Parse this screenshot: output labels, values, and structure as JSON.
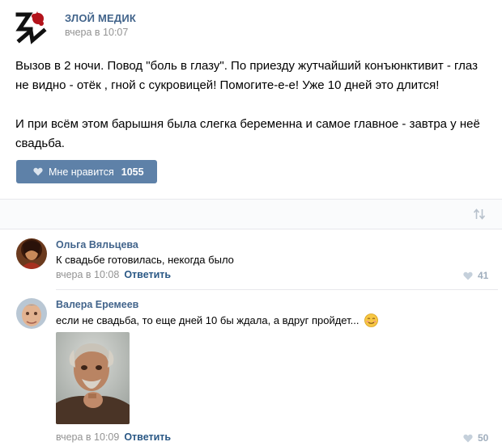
{
  "post": {
    "group_name": "ЗЛОЙ МЕДИК",
    "date": "вчера в 10:07",
    "paragraphs": [
      "Вызов в 2 ночи. Повод \"боль в глазу\". По приезду жутчайший конъюнктивит - глаз не видно - отёк , гной с сукровицей! Помогите-е-е! Уже 10 дней это длится!",
      "И при всём этом барышня была слегка беременна и самое главное - завтра у неё свадьба."
    ],
    "like_label": "Мне нравится",
    "like_count": "1055"
  },
  "comments": [
    {
      "author": "Ольга Вяльцева",
      "text": "К свадьбе готовилась, некогда было",
      "date": "вчера в 10:08",
      "reply_label": "Ответить",
      "likes": "41"
    },
    {
      "author": "Валера Еремеев",
      "text": "если не свадьба, то еще дней 10 бы ждала, а вдруг пройдет...",
      "date": "вчера в 10:09",
      "reply_label": "Ответить",
      "likes": "50"
    }
  ],
  "colors": {
    "link": "#42648b",
    "like_button": "#5e81a8",
    "muted": "#939393"
  },
  "icons": [
    "heart-icon",
    "sort-icon",
    "smiley-icon"
  ]
}
